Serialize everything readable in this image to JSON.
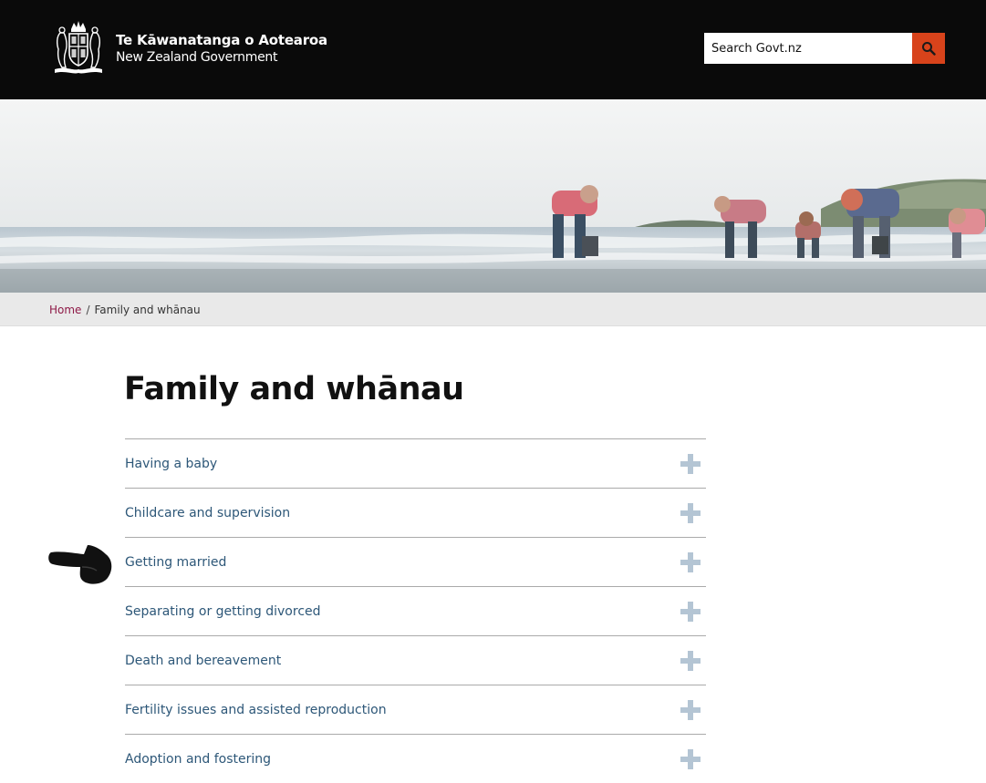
{
  "header": {
    "logo_line1": "Te Kāwanatanga o Aotearoa",
    "logo_line2": "New Zealand Government",
    "search_placeholder": "Search Govt.nz"
  },
  "breadcrumb": {
    "home": "Home",
    "separator": "/",
    "current": "Family and whānau"
  },
  "page": {
    "title": "Family and whānau"
  },
  "accordion": {
    "items": [
      {
        "label": "Having a baby"
      },
      {
        "label": "Childcare and supervision"
      },
      {
        "label": "Getting married"
      },
      {
        "label": "Separating or getting divorced"
      },
      {
        "label": "Death and bereavement"
      },
      {
        "label": "Fertility issues and assisted reproduction"
      },
      {
        "label": "Adoption and fostering"
      }
    ]
  },
  "icons": {
    "crest": "nz-coat-of-arms-icon",
    "search": "search-icon",
    "expand": "plus-icon",
    "pointer": "pointing-hand-icon"
  },
  "colors": {
    "header_bg": "#0a0a0a",
    "search_button": "#d8431b",
    "breadcrumb_bg": "#e9e9e9",
    "breadcrumb_link": "#8e1a47",
    "accordion_text": "#2d5778",
    "plus_icon": "#b4c5d4"
  }
}
